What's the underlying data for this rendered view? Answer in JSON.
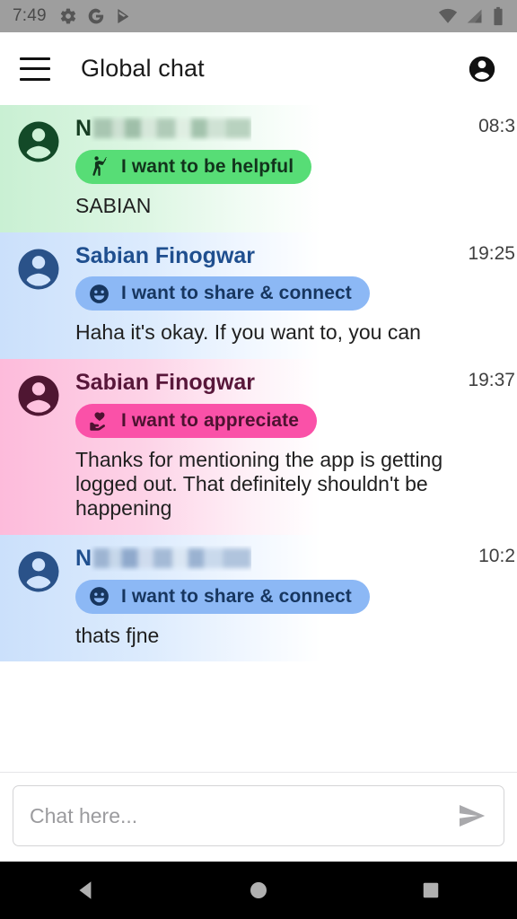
{
  "status_bar": {
    "time": "7:49",
    "left_icons": [
      "gear-icon",
      "google-g-icon",
      "play-store-icon"
    ],
    "right_icons": [
      "wifi-icon",
      "cell-signal-icon",
      "battery-icon"
    ],
    "background_color": "#9e9e9e"
  },
  "app_bar": {
    "menu_icon": "hamburger-menu-icon",
    "title": "Global chat",
    "account_icon": "account-circle-icon"
  },
  "messages": [
    {
      "tone": "green",
      "name": "N",
      "name_redacted": true,
      "time": "08:3",
      "badge_label": "I want to be helpful",
      "badge_icon": "person-raising-hand-icon",
      "badge_color": "#57dd76",
      "text": "SABIAN",
      "avatar_icon": "account-circle-icon",
      "avatar_color": "#134a28",
      "row_color": "#c9f0d3"
    },
    {
      "tone": "blue",
      "name": "Sabian Finogwar",
      "name_redacted": false,
      "time": "19:25",
      "badge_label": "I want to share & connect",
      "badge_icon": "smiley-face-icon",
      "badge_color": "#8cb8f5",
      "text": "Haha it's okay. If you want to, you can",
      "avatar_icon": "account-circle-icon",
      "avatar_color": "#2a5289",
      "row_color": "#cbe0fb"
    },
    {
      "tone": "pink",
      "name": "Sabian Finogwar",
      "name_redacted": false,
      "time": "19:37",
      "badge_label": "I want to appreciate",
      "badge_icon": "hand-holding-heart-icon",
      "badge_color": "#fa51a8",
      "text": "Thanks for mentioning the app is getting logged out. That definitely shouldn't be happening",
      "avatar_icon": "account-circle-icon",
      "avatar_color": "#4f1632",
      "row_color": "#fdbbdb"
    },
    {
      "tone": "blue",
      "name": "N",
      "name_redacted": true,
      "time": "10:2",
      "badge_label": "I want to share & connect",
      "badge_icon": "smiley-face-icon",
      "badge_color": "#8cb8f5",
      "text": "thats fjne",
      "avatar_icon": "account-circle-icon",
      "avatar_color": "#2a5289",
      "row_color": "#cbe0fb"
    }
  ],
  "composer": {
    "placeholder": "Chat here...",
    "value": "",
    "send_icon": "send-icon"
  },
  "nav_bar": {
    "back_icon": "back-triangle-icon",
    "home_icon": "home-circle-icon",
    "recents_icon": "recents-square-icon",
    "background_color": "#000000"
  }
}
